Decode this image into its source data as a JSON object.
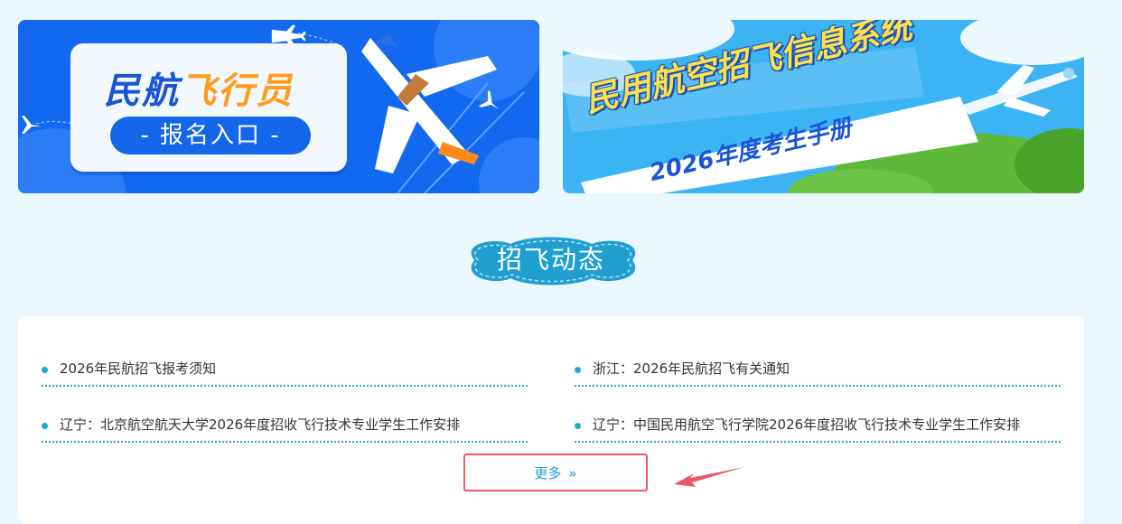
{
  "banners": {
    "left": {
      "title_part1": "民航",
      "title_part2": "飞行员",
      "entry_label": "- 报名入口 -"
    },
    "right": {
      "title": "民用航空招飞信息系统",
      "subtitle": "2026年度考生手册"
    }
  },
  "section": {
    "title": "招飞动态"
  },
  "news": [
    {
      "text": "2026年民航招飞报考须知"
    },
    {
      "text": "浙江：2026年民航招飞有关通知"
    },
    {
      "text": "辽宁：北京航空航天大学2026年度招收飞行技术专业学生工作安排"
    },
    {
      "text": "辽宁：中国民用航空飞行学院2026年度招收飞行技术专业学生工作安排"
    }
  ],
  "more": {
    "label": "更多",
    "icon": "double-chevron-right-icon"
  },
  "colors": {
    "page_bg": "#eaf7fd",
    "accent_blue": "#1368f0",
    "orange": "#ff9c1a",
    "highlight_red": "#ee5566",
    "dot_blue": "#1ea7d6"
  }
}
